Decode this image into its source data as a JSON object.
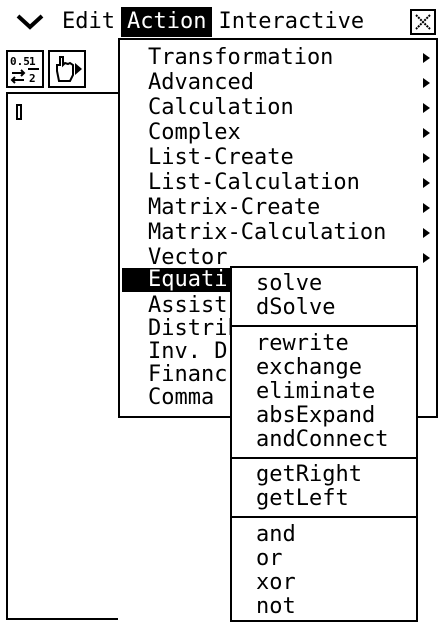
{
  "menubar": {
    "items": [
      {
        "label": "Edit"
      },
      {
        "label": "Action",
        "active": true
      },
      {
        "label": "Interactive"
      }
    ]
  },
  "toolbar": {
    "buttons": [
      {
        "label": "0.5 1/2",
        "icon": "fraction-decimal-toggle-icon"
      },
      {
        "label": "",
        "icon": "hand-pointer-icon"
      }
    ]
  },
  "menu": {
    "items": [
      {
        "label": "Transformation",
        "has_submenu": true
      },
      {
        "label": "Advanced",
        "has_submenu": true
      },
      {
        "label": "Calculation",
        "has_submenu": true
      },
      {
        "label": "Complex",
        "has_submenu": true
      },
      {
        "label": "List-Create",
        "has_submenu": true
      },
      {
        "label": "List-Calculation",
        "has_submenu": true
      },
      {
        "label": "Matrix-Create",
        "has_submenu": true
      },
      {
        "label": "Matrix-Calculation",
        "has_submenu": true
      },
      {
        "label": "Vector",
        "has_submenu": true
      },
      {
        "label": "Equati",
        "has_submenu": true,
        "active": true
      },
      {
        "label": "Assist",
        "has_submenu": true
      },
      {
        "label": "Distrib",
        "has_submenu": true
      },
      {
        "label": "Inv. D",
        "has_submenu": true
      },
      {
        "label": "Financ",
        "has_submenu": true
      },
      {
        "label": "Comma",
        "has_submenu": true
      }
    ]
  },
  "submenu": {
    "groups": [
      [
        "solve",
        "dSolve"
      ],
      [
        "rewrite",
        "exchange",
        "eliminate",
        "absExpand",
        "andConnect"
      ],
      [
        "getRight",
        "getLeft"
      ],
      [
        "and",
        "or",
        "xor",
        "not"
      ]
    ]
  }
}
